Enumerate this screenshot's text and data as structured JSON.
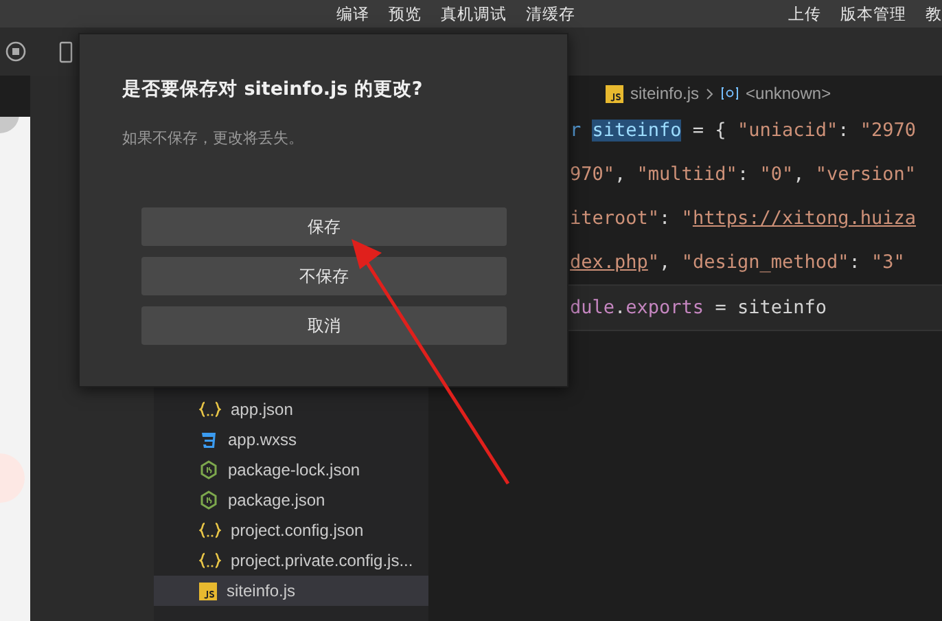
{
  "top_menu": {
    "left": [
      "编译",
      "预览",
      "真机调试",
      "清缓存"
    ],
    "right": [
      "上传",
      "版本管理",
      "教"
    ]
  },
  "dialog": {
    "title": "是否要保存对 siteinfo.js 的更改?",
    "message": "如果不保存，更改将丢失。",
    "buttons": [
      "保存",
      "不保存",
      "取消"
    ]
  },
  "breadcrumb": {
    "file": "siteinfo.js",
    "symbol": "<unknown>"
  },
  "code_lines": [
    {
      "current": false,
      "tokens": [
        {
          "text": "r ",
          "kind": "keyword"
        },
        {
          "text": "siteinfo",
          "kind": "match"
        },
        {
          "text": " = { ",
          "kind": "plain"
        },
        {
          "text": "\"uniacid\"",
          "kind": "string"
        },
        {
          "text": ": ",
          "kind": "plain"
        },
        {
          "text": "\"2970",
          "kind": "string"
        }
      ]
    },
    {
      "current": false,
      "tokens": [
        {
          "text": "970\"",
          "kind": "string"
        },
        {
          "text": ", ",
          "kind": "plain"
        },
        {
          "text": "\"multiid\"",
          "kind": "string"
        },
        {
          "text": ": ",
          "kind": "plain"
        },
        {
          "text": "\"0\"",
          "kind": "string"
        },
        {
          "text": ", ",
          "kind": "plain"
        },
        {
          "text": "\"version\"",
          "kind": "string"
        }
      ]
    },
    {
      "current": false,
      "tokens": [
        {
          "text": "iteroot\"",
          "kind": "string"
        },
        {
          "text": ": ",
          "kind": "plain"
        },
        {
          "text": "\"",
          "kind": "string"
        },
        {
          "text": "https://xitong.huiza",
          "kind": "link"
        }
      ]
    },
    {
      "current": false,
      "tokens": [
        {
          "text": "dex.php",
          "kind": "link"
        },
        {
          "text": "\"",
          "kind": "string"
        },
        {
          "text": ", ",
          "kind": "plain"
        },
        {
          "text": "\"design_method\"",
          "kind": "string"
        },
        {
          "text": ": ",
          "kind": "plain"
        },
        {
          "text": "\"3\"",
          "kind": "string"
        }
      ]
    },
    {
      "current": true,
      "tokens": [
        {
          "text": "dule",
          "kind": "variable"
        },
        {
          "text": ".",
          "kind": "plain"
        },
        {
          "text": "exports",
          "kind": "variable"
        },
        {
          "text": " = ",
          "kind": "plain"
        },
        {
          "text": "siteinfo",
          "kind": "plain"
        }
      ]
    }
  ],
  "file_tree": [
    {
      "name": "app.json",
      "kind": "json",
      "selected": false
    },
    {
      "name": "app.wxss",
      "kind": "css",
      "selected": false
    },
    {
      "name": "package-lock.json",
      "kind": "node",
      "selected": false
    },
    {
      "name": "package.json",
      "kind": "node",
      "selected": false
    },
    {
      "name": "project.config.json",
      "kind": "json",
      "selected": false
    },
    {
      "name": "project.private.config.js...",
      "kind": "json",
      "selected": false
    },
    {
      "name": "siteinfo.js",
      "kind": "js",
      "selected": true
    }
  ]
}
